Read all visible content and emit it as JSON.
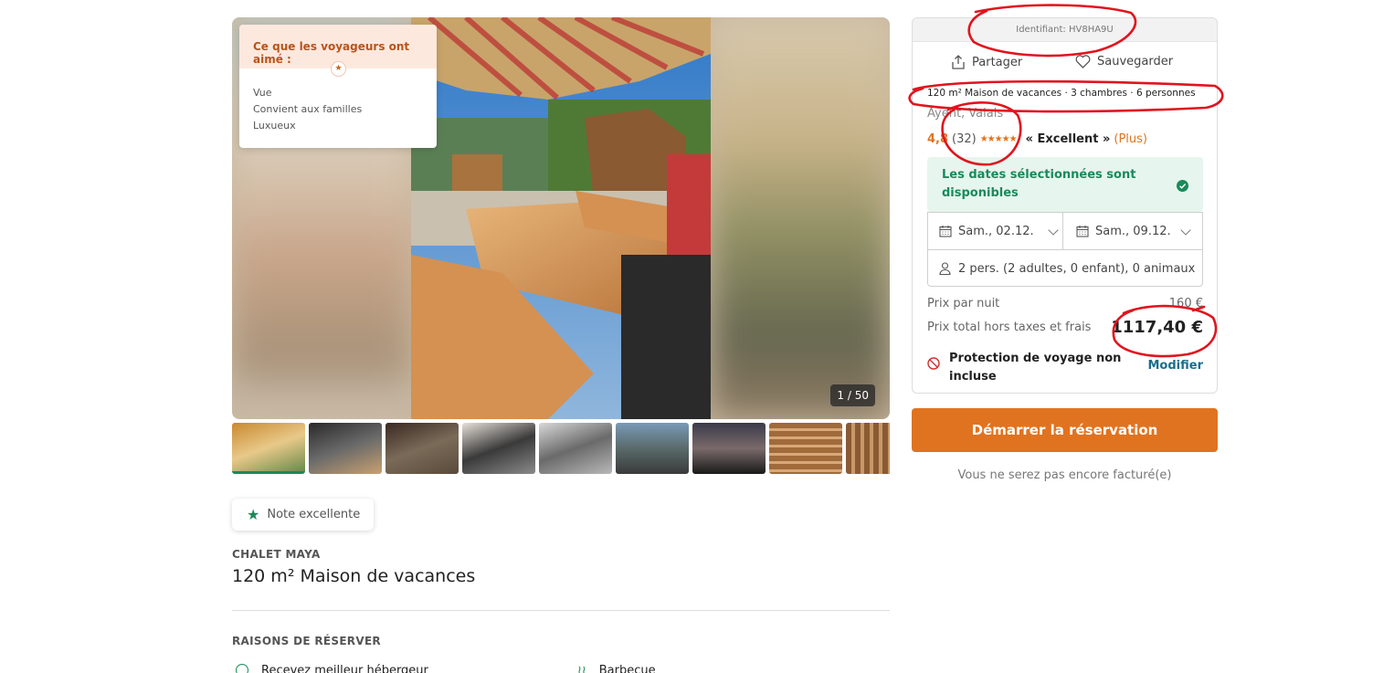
{
  "gallery": {
    "counter": "1 / 50",
    "liked": {
      "title": "Ce que les voyageurs ont aimé :",
      "items": [
        "Vue",
        "Convient aux familles",
        "Luxueux"
      ]
    }
  },
  "listing": {
    "badge": "Note excellente",
    "eyebrow": "CHALET MAYA",
    "title": "120 m² Maison de vacances",
    "reasons_title": "RAISONS DE RÉSERVER",
    "reasons": [
      "Recevez meilleur hébergeur",
      "Barbecue"
    ]
  },
  "panel": {
    "identifier": "Identifiant: HV8HA9U",
    "share": "Partager",
    "save": "Sauvegarder",
    "summary": "120 m² Maison de vacances · 3 chambres · 6 personnes",
    "location": "Ayent, Valais",
    "rating": {
      "score": "4,8",
      "count": "(32)",
      "stars": "★★★★★",
      "label": "« Excellent »",
      "more": "(Plus)"
    },
    "availability": "Les dates sélectionnées sont disponibles",
    "start_date": "Sam., 02.12.",
    "end_date": "Sam., 09.12.",
    "guests": "2 pers. (2 adultes, 0 enfant), 0 animaux",
    "nightly_label": "Prix par nuit",
    "nightly_value": "160 €",
    "total_label": "Prix total hors taxes et frais",
    "total_value": "1117,40 €",
    "protection": "Protection de voyage non incluse",
    "modify": "Modifier"
  },
  "cta": {
    "label": "Démarrer la réservation",
    "note": "Vous ne serez pas encore facturé(e)"
  },
  "colors": {
    "accent": "#e07320",
    "success": "#1a8a5a",
    "link": "#1a6e8c",
    "annotation": "#e0141e"
  }
}
